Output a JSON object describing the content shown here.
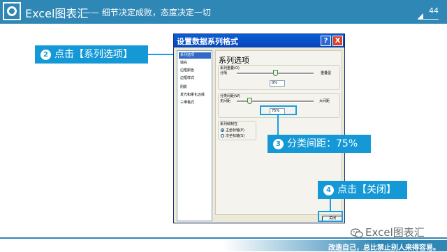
{
  "banner": {
    "brand": "Excel图表汇",
    "slogan": "—— 细节决定成败，态度决定一切",
    "page_number": "44"
  },
  "callouts": {
    "series_options": {
      "num": "2",
      "text": "点击【系列选项】"
    },
    "gap_width": {
      "num": "3",
      "text": "分类间距：75%"
    },
    "close": {
      "num": "4",
      "text": "点击【关闭】"
    }
  },
  "dialog": {
    "title": "设置数据系列格式",
    "help_label": "?",
    "close_label": "X",
    "nav_items": [
      "系列选项",
      "填充",
      "边框颜色",
      "边框样式",
      "阴影",
      "发光和柔化边缘",
      "三维格式"
    ],
    "panel_title": "系列选项",
    "overlap": {
      "label": "系列重叠(O)",
      "left": "分隔",
      "right": "重叠型",
      "value": "0%",
      "level_percent": 0
    },
    "gap": {
      "label": "分类间距(W)",
      "left": "无间距",
      "right": "大间距",
      "value": "75%",
      "level_percent": 15
    },
    "plot_on": {
      "label": "系列绘制在",
      "options": [
        "主坐标轴(P)",
        "次坐标轴(S)"
      ],
      "selected": 0
    },
    "close_button": "关闭"
  },
  "wechat_brand": "Excel图表汇",
  "footer_note": "改造自己，总比禁止别人来得容易。",
  "colors": {
    "accent": "#2f87b6",
    "callout": "#1599d6",
    "titlebar": "#0a5ed8"
  }
}
